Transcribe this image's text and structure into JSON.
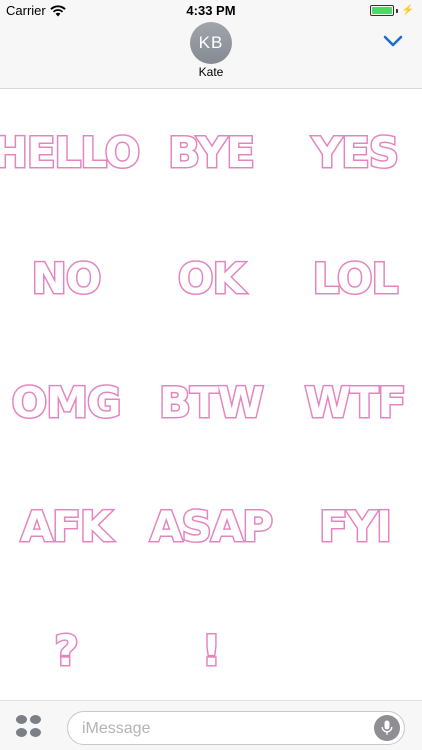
{
  "status_bar": {
    "carrier": "Carrier",
    "time": "4:33 PM",
    "battery_level": 1.0,
    "charging": true,
    "bolt_glyph": "⚡"
  },
  "header": {
    "avatar_initials": "KB",
    "contact_name": "Kate",
    "collapse_icon": "chevron-down-icon",
    "accent_color": "#1e6bd6"
  },
  "stickers": [
    {
      "text": "HELLO"
    },
    {
      "text": "BYE"
    },
    {
      "text": "YES"
    },
    {
      "text": "NO"
    },
    {
      "text": "OK"
    },
    {
      "text": "LOL"
    },
    {
      "text": "OMG"
    },
    {
      "text": "BTW"
    },
    {
      "text": "WTF"
    },
    {
      "text": "AFK"
    },
    {
      "text": "ASAP"
    },
    {
      "text": "FYI"
    },
    {
      "text": "?"
    },
    {
      "text": "!"
    }
  ],
  "sticker_color": "#e585c0",
  "input_bar": {
    "placeholder": "iMessage",
    "apps_icon": "app-drawer-icon",
    "mic_icon": "microphone-icon"
  }
}
